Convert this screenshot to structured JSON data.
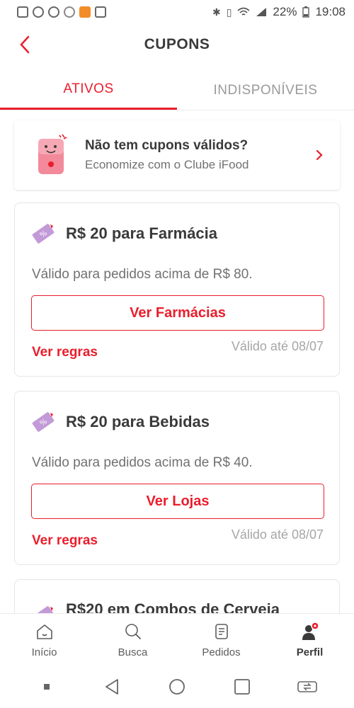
{
  "statusbar": {
    "battery": "22%",
    "time": "19:08"
  },
  "header": {
    "title": "CUPONS"
  },
  "tabs": [
    {
      "label": "ATIVOS"
    },
    {
      "label": "INDISPONÍVEIS"
    }
  ],
  "promo": {
    "title": "Não tem cupons válidos?",
    "subtitle": "Economize com o Clube iFood"
  },
  "coupons": [
    {
      "title": "R$ 20 para Farmácia",
      "description": "Válido para pedidos acima de R$ 80.",
      "button": "Ver Farmácias",
      "rules": "Ver regras",
      "validity": "Válido até 08/07"
    },
    {
      "title": "R$ 20 para Bebidas",
      "description": "Válido para pedidos acima de R$ 40.",
      "button": "Ver Lojas",
      "rules": "Ver regras",
      "validity": "Válido até 08/07"
    },
    {
      "title": "R$20 em Combos de Cerveja"
    }
  ],
  "bottom_nav": [
    {
      "label": "Início",
      "icon": "home-icon"
    },
    {
      "label": "Busca",
      "icon": "search-icon"
    },
    {
      "label": "Pedidos",
      "icon": "orders-icon"
    },
    {
      "label": "Perfil",
      "icon": "profile-icon"
    }
  ],
  "colors": {
    "accent": "#ea1d2c",
    "coupon_icon": "#c39ad8",
    "promo_icon": "#f28a9b"
  }
}
